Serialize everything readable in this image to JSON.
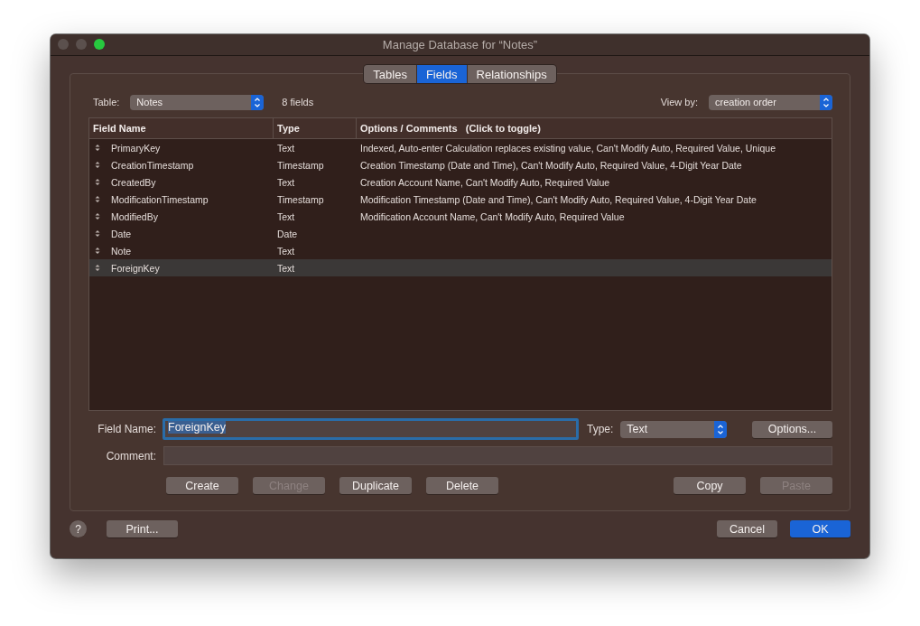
{
  "window": {
    "title": "Manage Database for “Notes”"
  },
  "tabs": [
    {
      "label": "Tables",
      "selected": false
    },
    {
      "label": "Fields",
      "selected": true
    },
    {
      "label": "Relationships",
      "selected": false
    }
  ],
  "table_selector": {
    "label": "Table:",
    "value": "Notes"
  },
  "field_count": "8 fields",
  "view_by": {
    "label": "View by:",
    "value": "creation order"
  },
  "columns": [
    "Field Name",
    "Type",
    "Options / Comments   (Click to toggle)"
  ],
  "rows": [
    {
      "name": "PrimaryKey",
      "type": "Text",
      "options": "Indexed, Auto-enter Calculation replaces existing value, Can't Modify Auto, Required Value, Unique",
      "selected": false
    },
    {
      "name": "CreationTimestamp",
      "type": "Timestamp",
      "options": "Creation Timestamp (Date and Time), Can't Modify Auto, Required Value, 4-Digit Year Date",
      "selected": false
    },
    {
      "name": "CreatedBy",
      "type": "Text",
      "options": "Creation Account Name, Can't Modify Auto, Required Value",
      "selected": false
    },
    {
      "name": "ModificationTimestamp",
      "type": "Timestamp",
      "options": "Modification Timestamp (Date and Time), Can't Modify Auto, Required Value, 4-Digit Year Date",
      "selected": false
    },
    {
      "name": "ModifiedBy",
      "type": "Text",
      "options": "Modification Account Name, Can't Modify Auto, Required Value",
      "selected": false
    },
    {
      "name": "Date",
      "type": "Date",
      "selected": false
    },
    {
      "name": "Note",
      "type": "Text",
      "selected": false
    },
    {
      "name": "ForeignKey",
      "type": "Text",
      "selected": true
    }
  ],
  "field_name": {
    "label": "Field Name:",
    "value": "ForeignKey"
  },
  "type_selector": {
    "label": "Type:",
    "value": "Text"
  },
  "options_button": "Options...",
  "comment": {
    "label": "Comment:"
  },
  "left_actions": [
    {
      "label": "Create",
      "disabled": false
    },
    {
      "label": "Change",
      "disabled": true
    },
    {
      "label": "Duplicate",
      "disabled": false
    },
    {
      "label": "Delete",
      "disabled": false
    }
  ],
  "right_actions": [
    {
      "label": "Copy",
      "disabled": false
    },
    {
      "label": "Paste",
      "disabled": true
    }
  ],
  "help_button": "?",
  "print_button": "Print...",
  "dialog_buttons": [
    {
      "label": "Cancel",
      "primary": false
    },
    {
      "label": "OK",
      "primary": true
    }
  ]
}
